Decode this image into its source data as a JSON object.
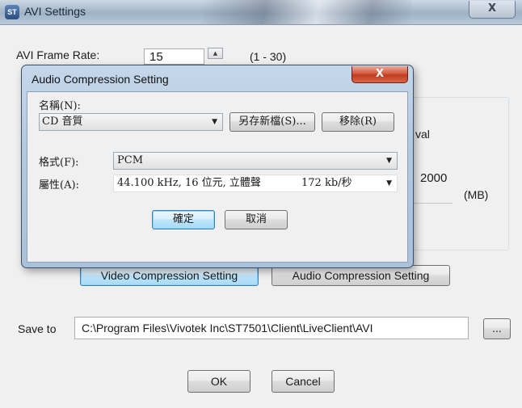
{
  "window": {
    "title": "AVI Settings",
    "app_icon": "ST",
    "close_glyph": "X"
  },
  "frame_rate": {
    "label": "AVI Frame Rate:",
    "value": "15",
    "range": "(1 - 30)"
  },
  "group": {
    "interval_fragment": "val",
    "size_value": "2000",
    "size_unit": "(MB)"
  },
  "buttons": {
    "video_compression": "Video Compression Setting",
    "audio_compression": "Audio Compression Setting",
    "browse": "...",
    "ok": "OK",
    "cancel": "Cancel"
  },
  "save": {
    "label": "Save to",
    "path": "C:\\Program Files\\Vivotek Inc\\ST7501\\Client\\LiveClient\\AVI"
  },
  "dialog": {
    "title": "Audio Compression Setting",
    "close_glyph": "X",
    "name_label": "名稱(N):",
    "name_value": "CD 音質",
    "save_as_button": "另存新檔(S)...",
    "remove_button": "移除(R)",
    "format_label": "格式(F):",
    "format_value": "PCM",
    "attributes_label": "屬性(A):",
    "attributes_value": "44.100 kHz, 16 位元, 立體聲",
    "attributes_rate": "172 kb/秒",
    "ok_button": "確定",
    "cancel_button": "取消"
  },
  "icons": {
    "dropdown": "chevron-down-icon",
    "spin": "spin-up-icon"
  }
}
